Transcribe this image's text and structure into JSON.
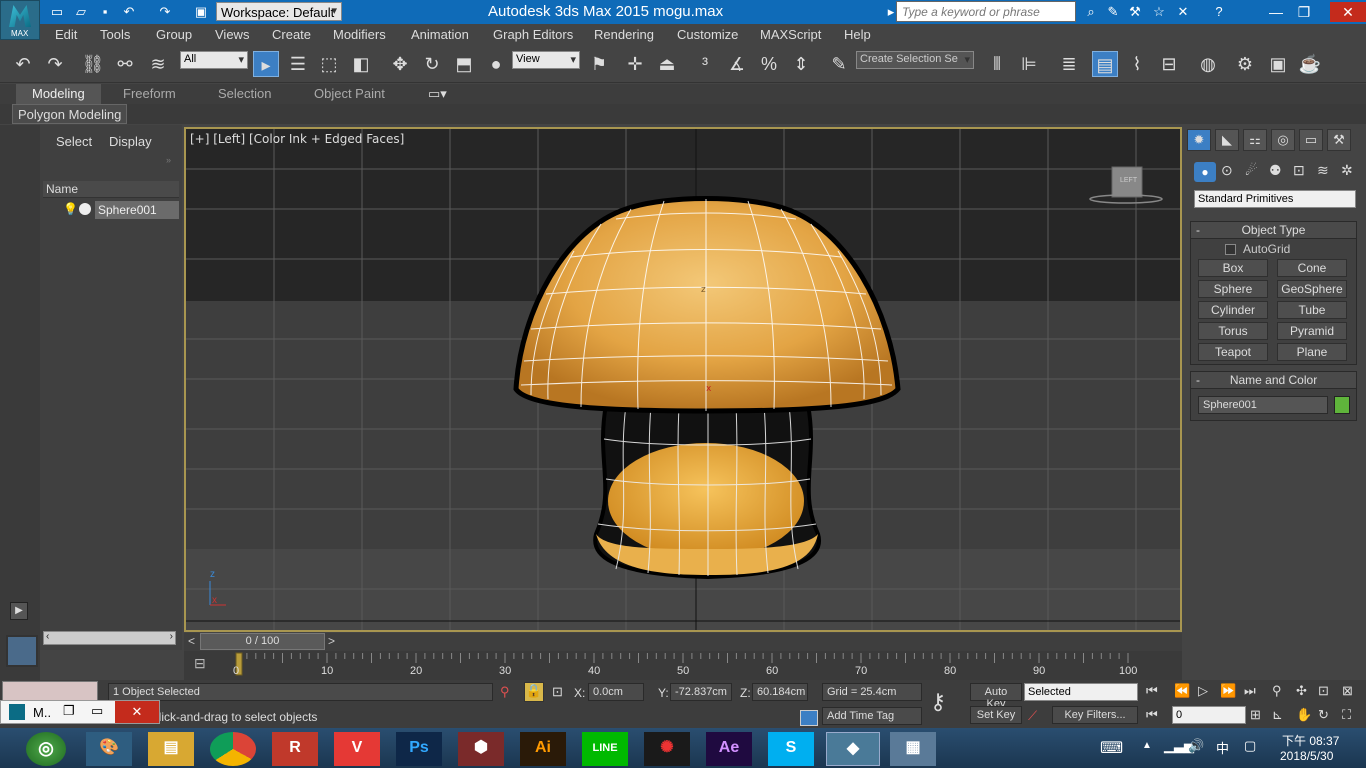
{
  "title": {
    "app_title": "Autodesk 3ds Max  2015     mogu.max",
    "workspace": "Workspace: Default",
    "search_placeholder": "Type a keyword or phrase",
    "logo_text": "MAX"
  },
  "menu": [
    "Edit",
    "Tools",
    "Group",
    "Views",
    "Create",
    "Modifiers",
    "Animation",
    "Graph Editors",
    "Rendering",
    "Customize",
    "MAXScript",
    "Help"
  ],
  "toolbar": {
    "filter_value": "All",
    "ref_coord_value": "View",
    "selection_set_placeholder": "Create Selection Se"
  },
  "ribbon": {
    "tabs": [
      "Modeling",
      "Freeform",
      "Selection",
      "Object Paint"
    ],
    "subtitle": "Polygon Modeling"
  },
  "scene_explorer": {
    "tab_select": "Select",
    "tab_display": "Display",
    "column_name": "Name",
    "object": "Sphere001"
  },
  "viewport": {
    "label": "[+] [Left] [Color Ink + Edged Faces]",
    "viewcube_label": "LEFT",
    "axis_z": "z",
    "axis_x": "x"
  },
  "timeline": {
    "frame": "0 / 100",
    "ticks": [
      "0",
      "10",
      "20",
      "30",
      "40",
      "50",
      "60",
      "70",
      "80",
      "90",
      "100"
    ]
  },
  "status": {
    "selected": "1 Object Selected",
    "prompt": "Click-and-drag to select objects",
    "x_label": "X:",
    "x_value": "0.0cm",
    "y_label": "Y:",
    "y_value": "-72.837cm",
    "z_label": "Z:",
    "z_value": "60.184cm",
    "grid": "Grid = 25.4cm",
    "add_time_tag": "Add Time Tag",
    "auto_key": "Auto Key",
    "set_key": "Set Key",
    "key_mode": "Selected",
    "key_filters": "Key Filters...",
    "frame_value": "0"
  },
  "command_panel": {
    "category": "Standard Primitives",
    "object_type_title": "Object Type",
    "autogrid": "AutoGrid",
    "buttons": [
      "Box",
      "Cone",
      "Sphere",
      "GeoSphere",
      "Cylinder",
      "Tube",
      "Torus",
      "Pyramid",
      "Teapot",
      "Plane"
    ],
    "name_color_title": "Name and Color",
    "object_name": "Sphere001",
    "object_color": "#5fb43b"
  },
  "taskbar": {
    "popup_label": "M..",
    "time": "下午 08:37",
    "date": "2018/5/30",
    "ime": "中",
    "apps": [
      "Ps",
      "Ai",
      "LINE",
      "Ae",
      "S",
      "R"
    ]
  },
  "colors": {
    "title_bar": "#0f6bb8",
    "ui_bg": "#444444",
    "active_tool": "#3c7fc4",
    "viewport_border": "#a89650",
    "mushroom": "#e8a948"
  }
}
